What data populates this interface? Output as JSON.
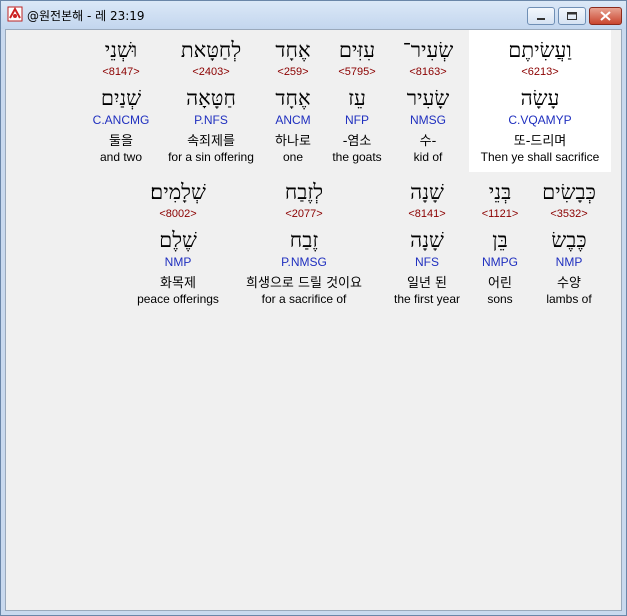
{
  "window": {
    "title": "@원전본해 - 레 23:19"
  },
  "row1": [
    {
      "hebrew": "וַעֲשִׂיתֶם",
      "strong": "<6213>",
      "root": "עָשָׂה",
      "morph": "C.VQAMYP",
      "korean": "또-드리며",
      "english": "Then ye shall sacrifice"
    },
    {
      "hebrew": "שְׂעִיר־",
      "strong": "<8163>",
      "root": "שָׂעִיר",
      "morph": "NMSG",
      "korean": "수-",
      "english": "kid of"
    },
    {
      "hebrew": "עִזִּים",
      "strong": "<5795>",
      "root": "עֵז",
      "morph": "NFP",
      "korean": "-염소",
      "english": "the goats"
    },
    {
      "hebrew": "אֶחָד",
      "strong": "<259>",
      "root": "אֶחָד",
      "morph": "ANCM",
      "korean": "하나로",
      "english": "one"
    },
    {
      "hebrew": "לְחַטָּאת",
      "strong": "<2403>",
      "root": "חַטָּאָה",
      "morph": "P.NFS",
      "korean": "속죄제를",
      "english": "for a sin offering"
    },
    {
      "hebrew": "וּשְׁנֵי",
      "strong": "<8147>",
      "root": "שְׁנַיִם",
      "morph": "C.ANCMG",
      "korean": "둘을",
      "english": "and two"
    }
  ],
  "row2": [
    {
      "hebrew": "כְּבָשִׂים",
      "strong": "<3532>",
      "root": "כֶּבֶשׂ",
      "morph": "NMP",
      "korean": "수양",
      "english": "lambs of"
    },
    {
      "hebrew": "בְּנֵי",
      "strong": "<1121>",
      "root": "בֵּן",
      "morph": "NMPG",
      "korean": "어린",
      "english": "sons"
    },
    {
      "hebrew": "שָׁנָה",
      "strong": "<8141>",
      "root": "שָׁנָה",
      "morph": "NFS",
      "korean": "일년 된",
      "english": "the first year"
    },
    {
      "hebrew": "לְזֶבַח",
      "strong": "<2077>",
      "root": "זֶבַח",
      "morph": "P.NMSG",
      "korean": "희생으로 드릴 것이요",
      "english": "for a sacrifice of"
    },
    {
      "hebrew": "שְׁלָמִים׃",
      "strong": "<8002>",
      "root": "שֶׁלֶם",
      "morph": "NMP",
      "korean": "화목제",
      "english": "peace offerings"
    }
  ]
}
